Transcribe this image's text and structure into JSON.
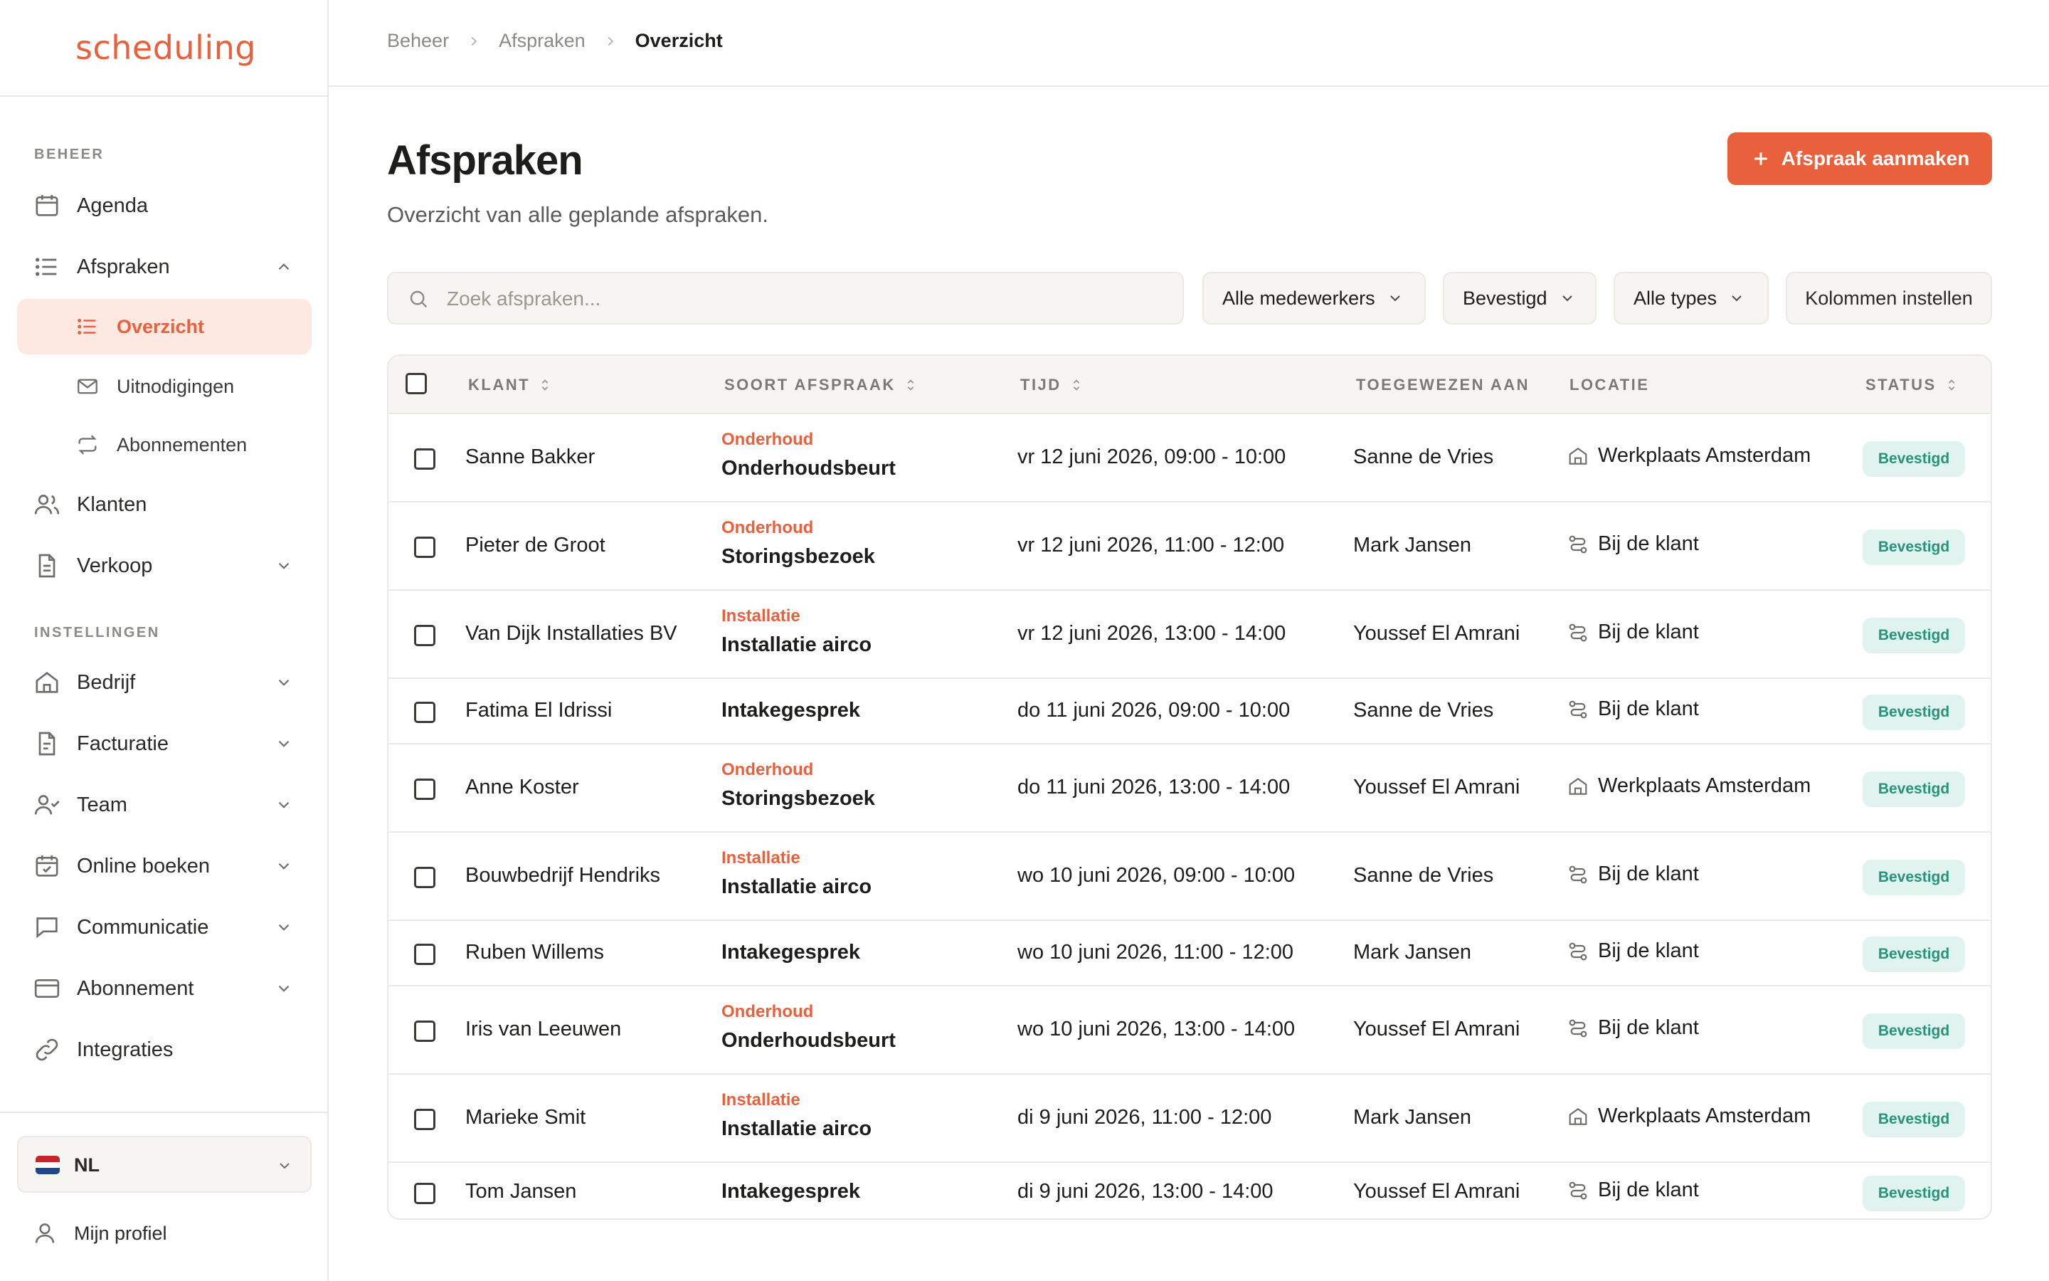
{
  "app": {
    "logo": "scheduling"
  },
  "sidebar": {
    "section_beheer": "BEHEER",
    "section_instellingen": "INSTELLINGEN",
    "agenda": "Agenda",
    "afspraken": "Afspraken",
    "overzicht": "Overzicht",
    "uitnodigingen": "Uitnodigingen",
    "abonnementen": "Abonnementen",
    "klanten": "Klanten",
    "verkoop": "Verkoop",
    "bedrijf": "Bedrijf",
    "facturatie": "Facturatie",
    "team": "Team",
    "online_boeken": "Online boeken",
    "communicatie": "Communicatie",
    "abonnement": "Abonnement",
    "integraties": "Integraties",
    "language": "NL",
    "profile": "Mijn profiel"
  },
  "breadcrumb": [
    "Beheer",
    "Afspraken",
    "Overzicht"
  ],
  "page": {
    "title": "Afspraken",
    "subtitle": "Overzicht van alle geplande afspraken.",
    "create_button": "Afspraak aanmaken"
  },
  "filters": {
    "search_placeholder": "Zoek afspraken...",
    "medewerkers": "Alle medewerkers",
    "status": "Bevestigd",
    "types": "Alle types",
    "columns": "Kolommen instellen"
  },
  "table": {
    "headers": {
      "klant": "KLANT",
      "soort": "SOORT AFSPRAAK",
      "tijd": "TIJD",
      "toegewezen": "TOEGEWEZEN AAN",
      "locatie": "LOCATIE",
      "status": "STATUS"
    },
    "rows": [
      {
        "klant": "Sanne Bakker",
        "tag": "Onderhoud",
        "service": "Onderhoudsbeurt",
        "tijd": "vr 12 juni 2026, 09:00 - 10:00",
        "medewerker": "Sanne de Vries",
        "locatie": "Werkplaats Amsterdam",
        "status": "Bevestigd"
      },
      {
        "klant": "Pieter de Groot",
        "tag": "Onderhoud",
        "service": "Storingsbezoek",
        "tijd": "vr 12 juni 2026, 11:00 - 12:00",
        "medewerker": "Mark Jansen",
        "locatie": "Bij de klant",
        "status": "Bevestigd"
      },
      {
        "klant": "Van Dijk Installaties BV",
        "tag": "Installatie",
        "service": "Installatie airco",
        "tijd": "vr 12 juni 2026, 13:00 - 14:00",
        "medewerker": "Youssef El Amrani",
        "locatie": "Bij de klant",
        "status": "Bevestigd"
      },
      {
        "klant": "Fatima El Idrissi",
        "tag": "",
        "service": "Intakegesprek",
        "tijd": "do 11 juni 2026, 09:00 - 10:00",
        "medewerker": "Sanne de Vries",
        "locatie": "Bij de klant",
        "status": "Bevestigd"
      },
      {
        "klant": "Anne Koster",
        "tag": "Onderhoud",
        "service": "Storingsbezoek",
        "tijd": "do 11 juni 2026, 13:00 - 14:00",
        "medewerker": "Youssef El Amrani",
        "locatie": "Werkplaats Amsterdam",
        "status": "Bevestigd"
      },
      {
        "klant": "Bouwbedrijf Hendriks",
        "tag": "Installatie",
        "service": "Installatie airco",
        "tijd": "wo 10 juni 2026, 09:00 - 10:00",
        "medewerker": "Sanne de Vries",
        "locatie": "Bij de klant",
        "status": "Bevestigd"
      },
      {
        "klant": "Ruben Willems",
        "tag": "",
        "service": "Intakegesprek",
        "tijd": "wo 10 juni 2026, 11:00 - 12:00",
        "medewerker": "Mark Jansen",
        "locatie": "Bij de klant",
        "status": "Bevestigd"
      },
      {
        "klant": "Iris van Leeuwen",
        "tag": "Onderhoud",
        "service": "Onderhoudsbeurt",
        "tijd": "wo 10 juni 2026, 13:00 - 14:00",
        "medewerker": "Youssef El Amrani",
        "locatie": "Bij de klant",
        "status": "Bevestigd"
      },
      {
        "klant": "Marieke Smit",
        "tag": "Installatie",
        "service": "Installatie airco",
        "tijd": "di 9 juni 2026, 11:00 - 12:00",
        "medewerker": "Mark Jansen",
        "locatie": "Werkplaats Amsterdam",
        "status": "Bevestigd"
      },
      {
        "klant": "Tom Jansen",
        "tag": "",
        "service": "Intakegesprek",
        "tijd": "di 9 juni 2026, 13:00 - 14:00",
        "medewerker": "Youssef El Amrani",
        "locatie": "Bij de klant",
        "status": "Bevestigd"
      }
    ]
  },
  "colors": {
    "accent": "#e8603c",
    "badge_bg": "#e1f3ee",
    "badge_text": "#27937a"
  }
}
